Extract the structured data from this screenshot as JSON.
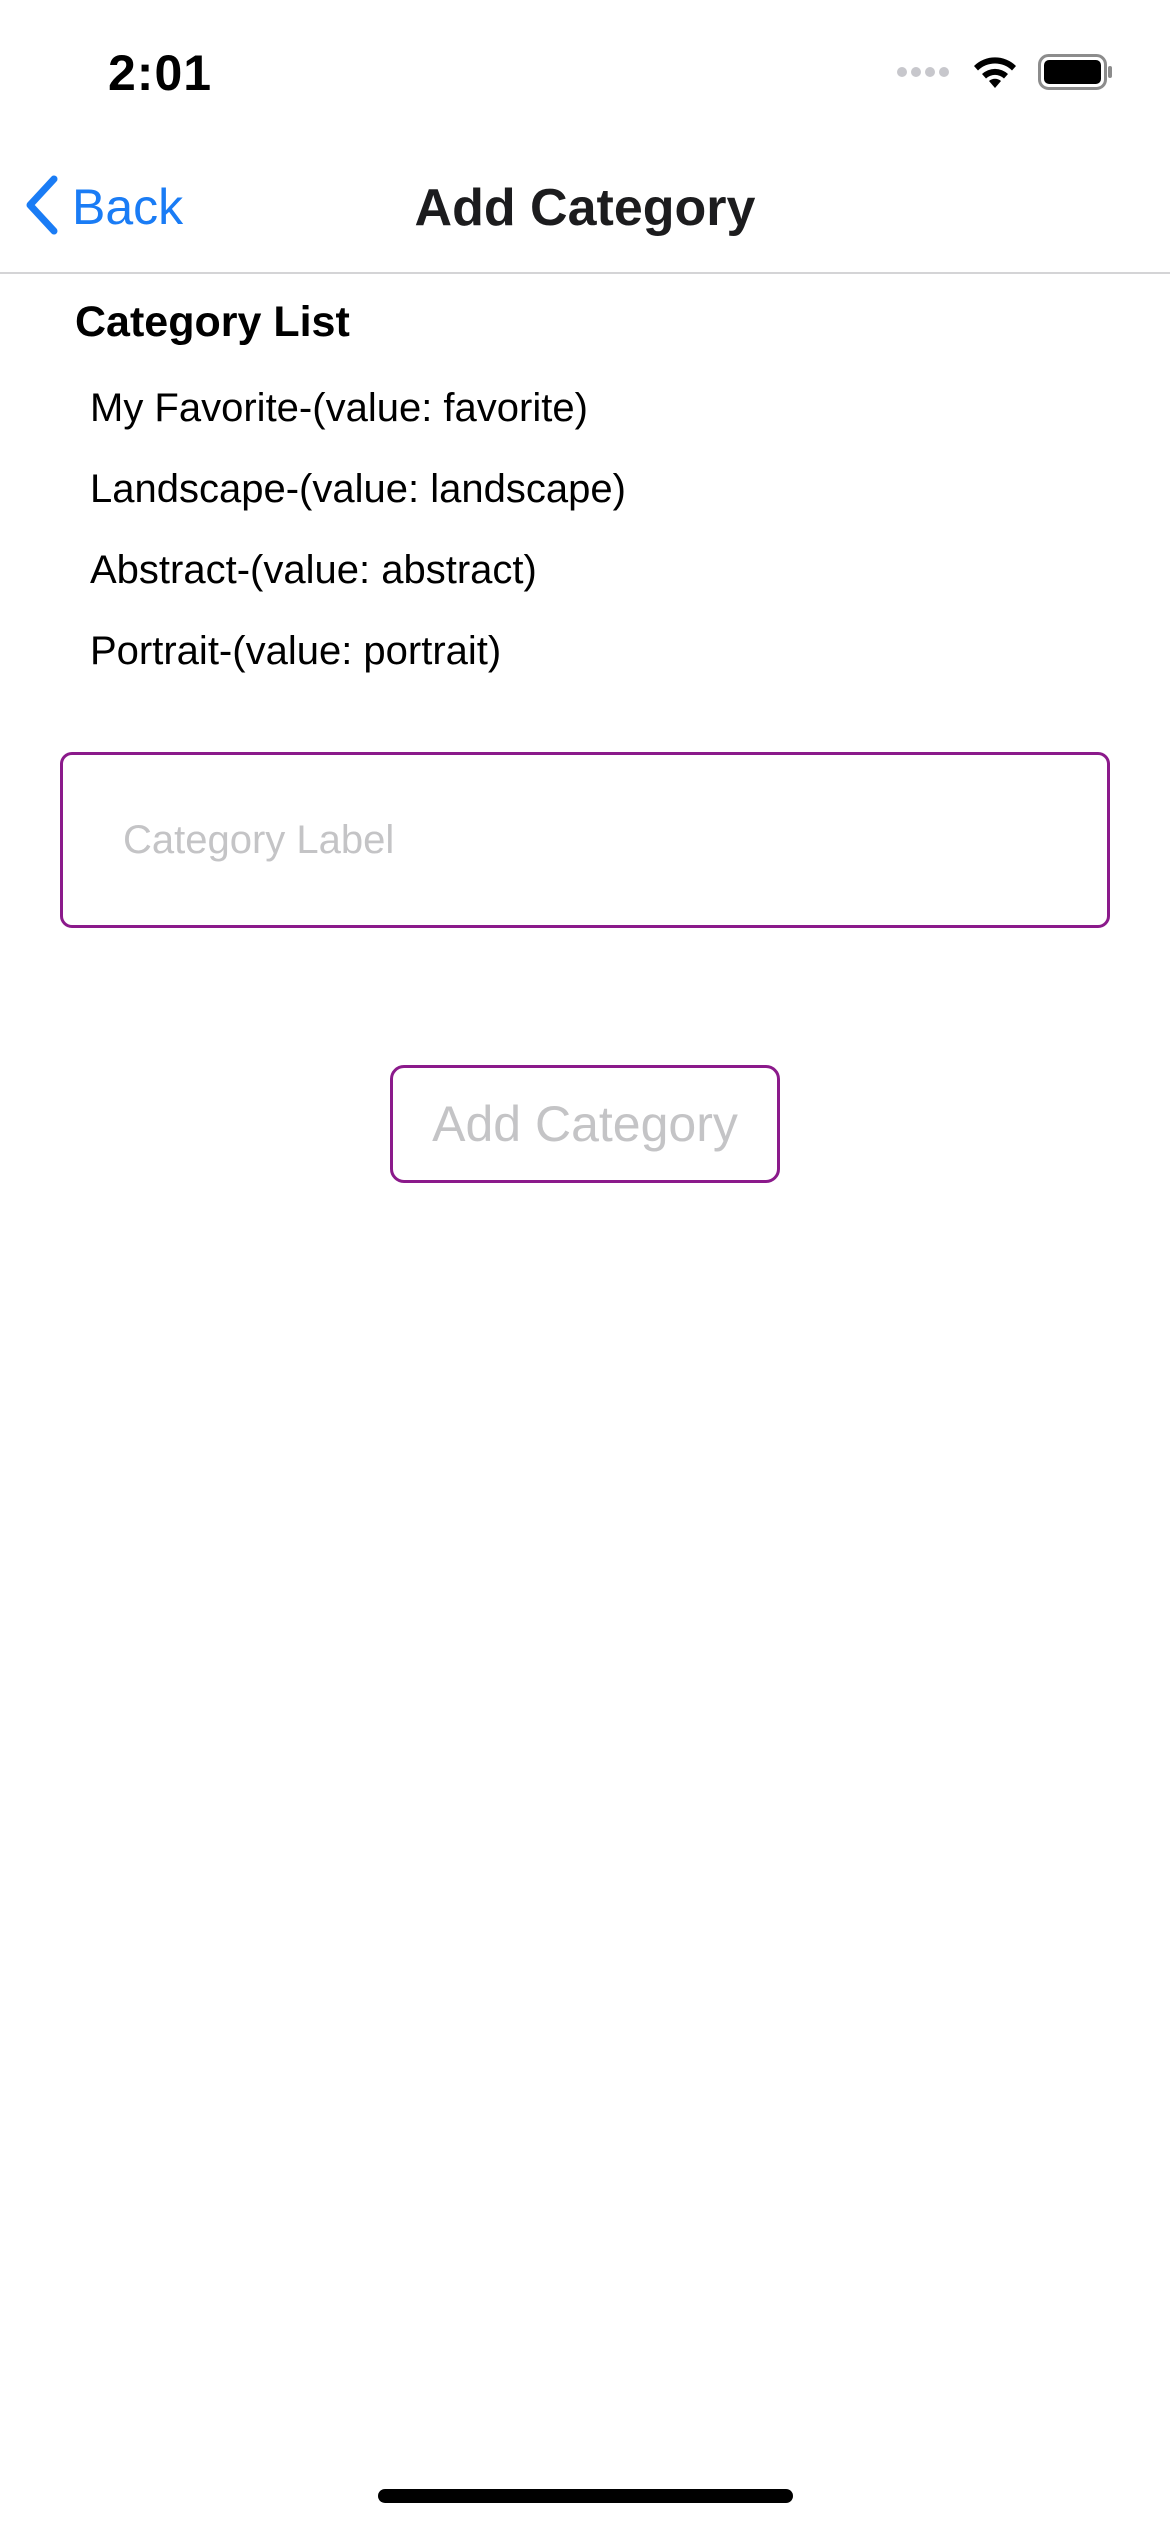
{
  "status_bar": {
    "time": "2:01",
    "icons": [
      "signal-dots-icon",
      "wifi-icon",
      "battery-icon"
    ]
  },
  "nav": {
    "back_label": "Back",
    "title": "Add Category",
    "back_icon": "chevron-left-icon",
    "accent_color": "#1a7cf5"
  },
  "category_list": {
    "heading": "Category List",
    "items": [
      {
        "label": "My Favorite-(value: favorite)"
      },
      {
        "label": "Landscape-(value: landscape)"
      },
      {
        "label": "Abstract-(value: abstract)"
      },
      {
        "label": "Portrait-(value: portrait)"
      }
    ]
  },
  "form": {
    "input_value": "",
    "input_placeholder": "Category Label",
    "submit_label": "Add Category",
    "border_color": "#8b1a8b"
  }
}
